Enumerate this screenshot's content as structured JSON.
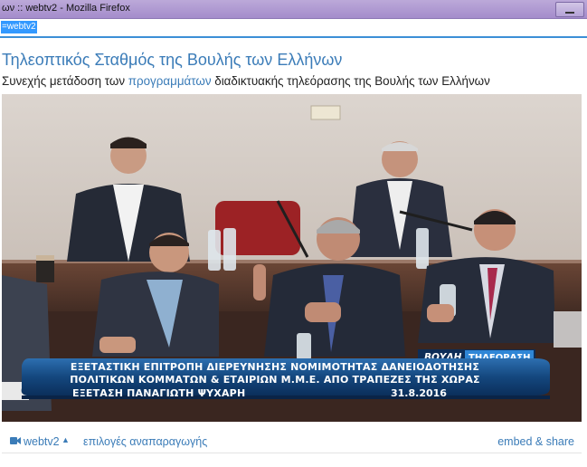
{
  "window": {
    "title": "ων :: webtv2 - Mozilla Firefox"
  },
  "urlbar": {
    "selected_text": "=webtv2"
  },
  "page": {
    "title": "Τηλεοπτικός Σταθμός της Βουλής των Ελλήνων",
    "subtitle_before": "Συνεχής μετάδοση των ",
    "subtitle_link": "προγραμμάτων",
    "subtitle_after": " διαδικτυακής τηλεόρασης της Βουλής των Ελλήνων"
  },
  "video": {
    "logo_left": "ΒΟΥΛΗ",
    "logo_right": "ΤΗΛΕΟΡΑΣΗ",
    "caption_line1": "ΕΞΕΤΑΣΤΙΚΗ ΕΠΙΤΡΟΠΗ ΔΙΕΡΕΥΝΗΣΗΣ ΝΟΜΙΜΟΤΗΤΑΣ ΔΑΝΕΙΟΔΟΤΗΣΗΣ",
    "caption_line2": "ΠΟΛΙΤΙΚΩΝ ΚΟΜΜΑΤΩΝ & ΕΤΑΙΡΙΩΝ Μ.Μ.Ε. ΑΠΟ ΤΡΑΠΕΖΕΣ ΤΗΣ ΧΩΡΑΣ",
    "caption_line3": "ΕΞΕΤΑΣΗ ΠΑΝΑΓΙΩΤΗ ΨΥΧΑΡΗ",
    "caption_date": "31.8.2016"
  },
  "controls": {
    "stream_label": "webtv2",
    "playback_options": "επιλογές αναπαραγωγής",
    "embed_share": "embed & share"
  },
  "icons": {
    "stream": "video-camera-icon",
    "caret": "caret-up-icon"
  }
}
